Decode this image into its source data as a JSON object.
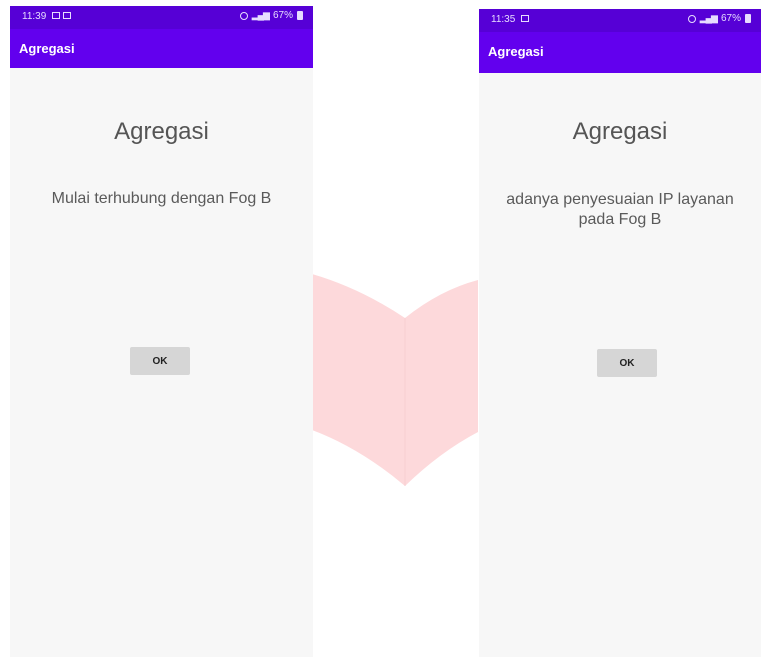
{
  "colors": {
    "status_bar": "#5600d6",
    "app_bar": "#6200ee",
    "screen_bg": "#f7f7f7",
    "button_bg": "#d6d6d6",
    "arrow": "#fdd9db"
  },
  "left_screen": {
    "status": {
      "time": "11:39",
      "battery": "67%"
    },
    "app_bar_title": "Agregasi",
    "heading": "Agregasi",
    "message": "Mulai terhubung dengan Fog B",
    "ok_label": "OK"
  },
  "right_screen": {
    "status": {
      "time": "11:35",
      "battery": "67%"
    },
    "app_bar_title": "Agregasi",
    "heading": "Agregasi",
    "message": "adanya penyesuaian IP layanan pada Fog B",
    "ok_label": "OK"
  }
}
